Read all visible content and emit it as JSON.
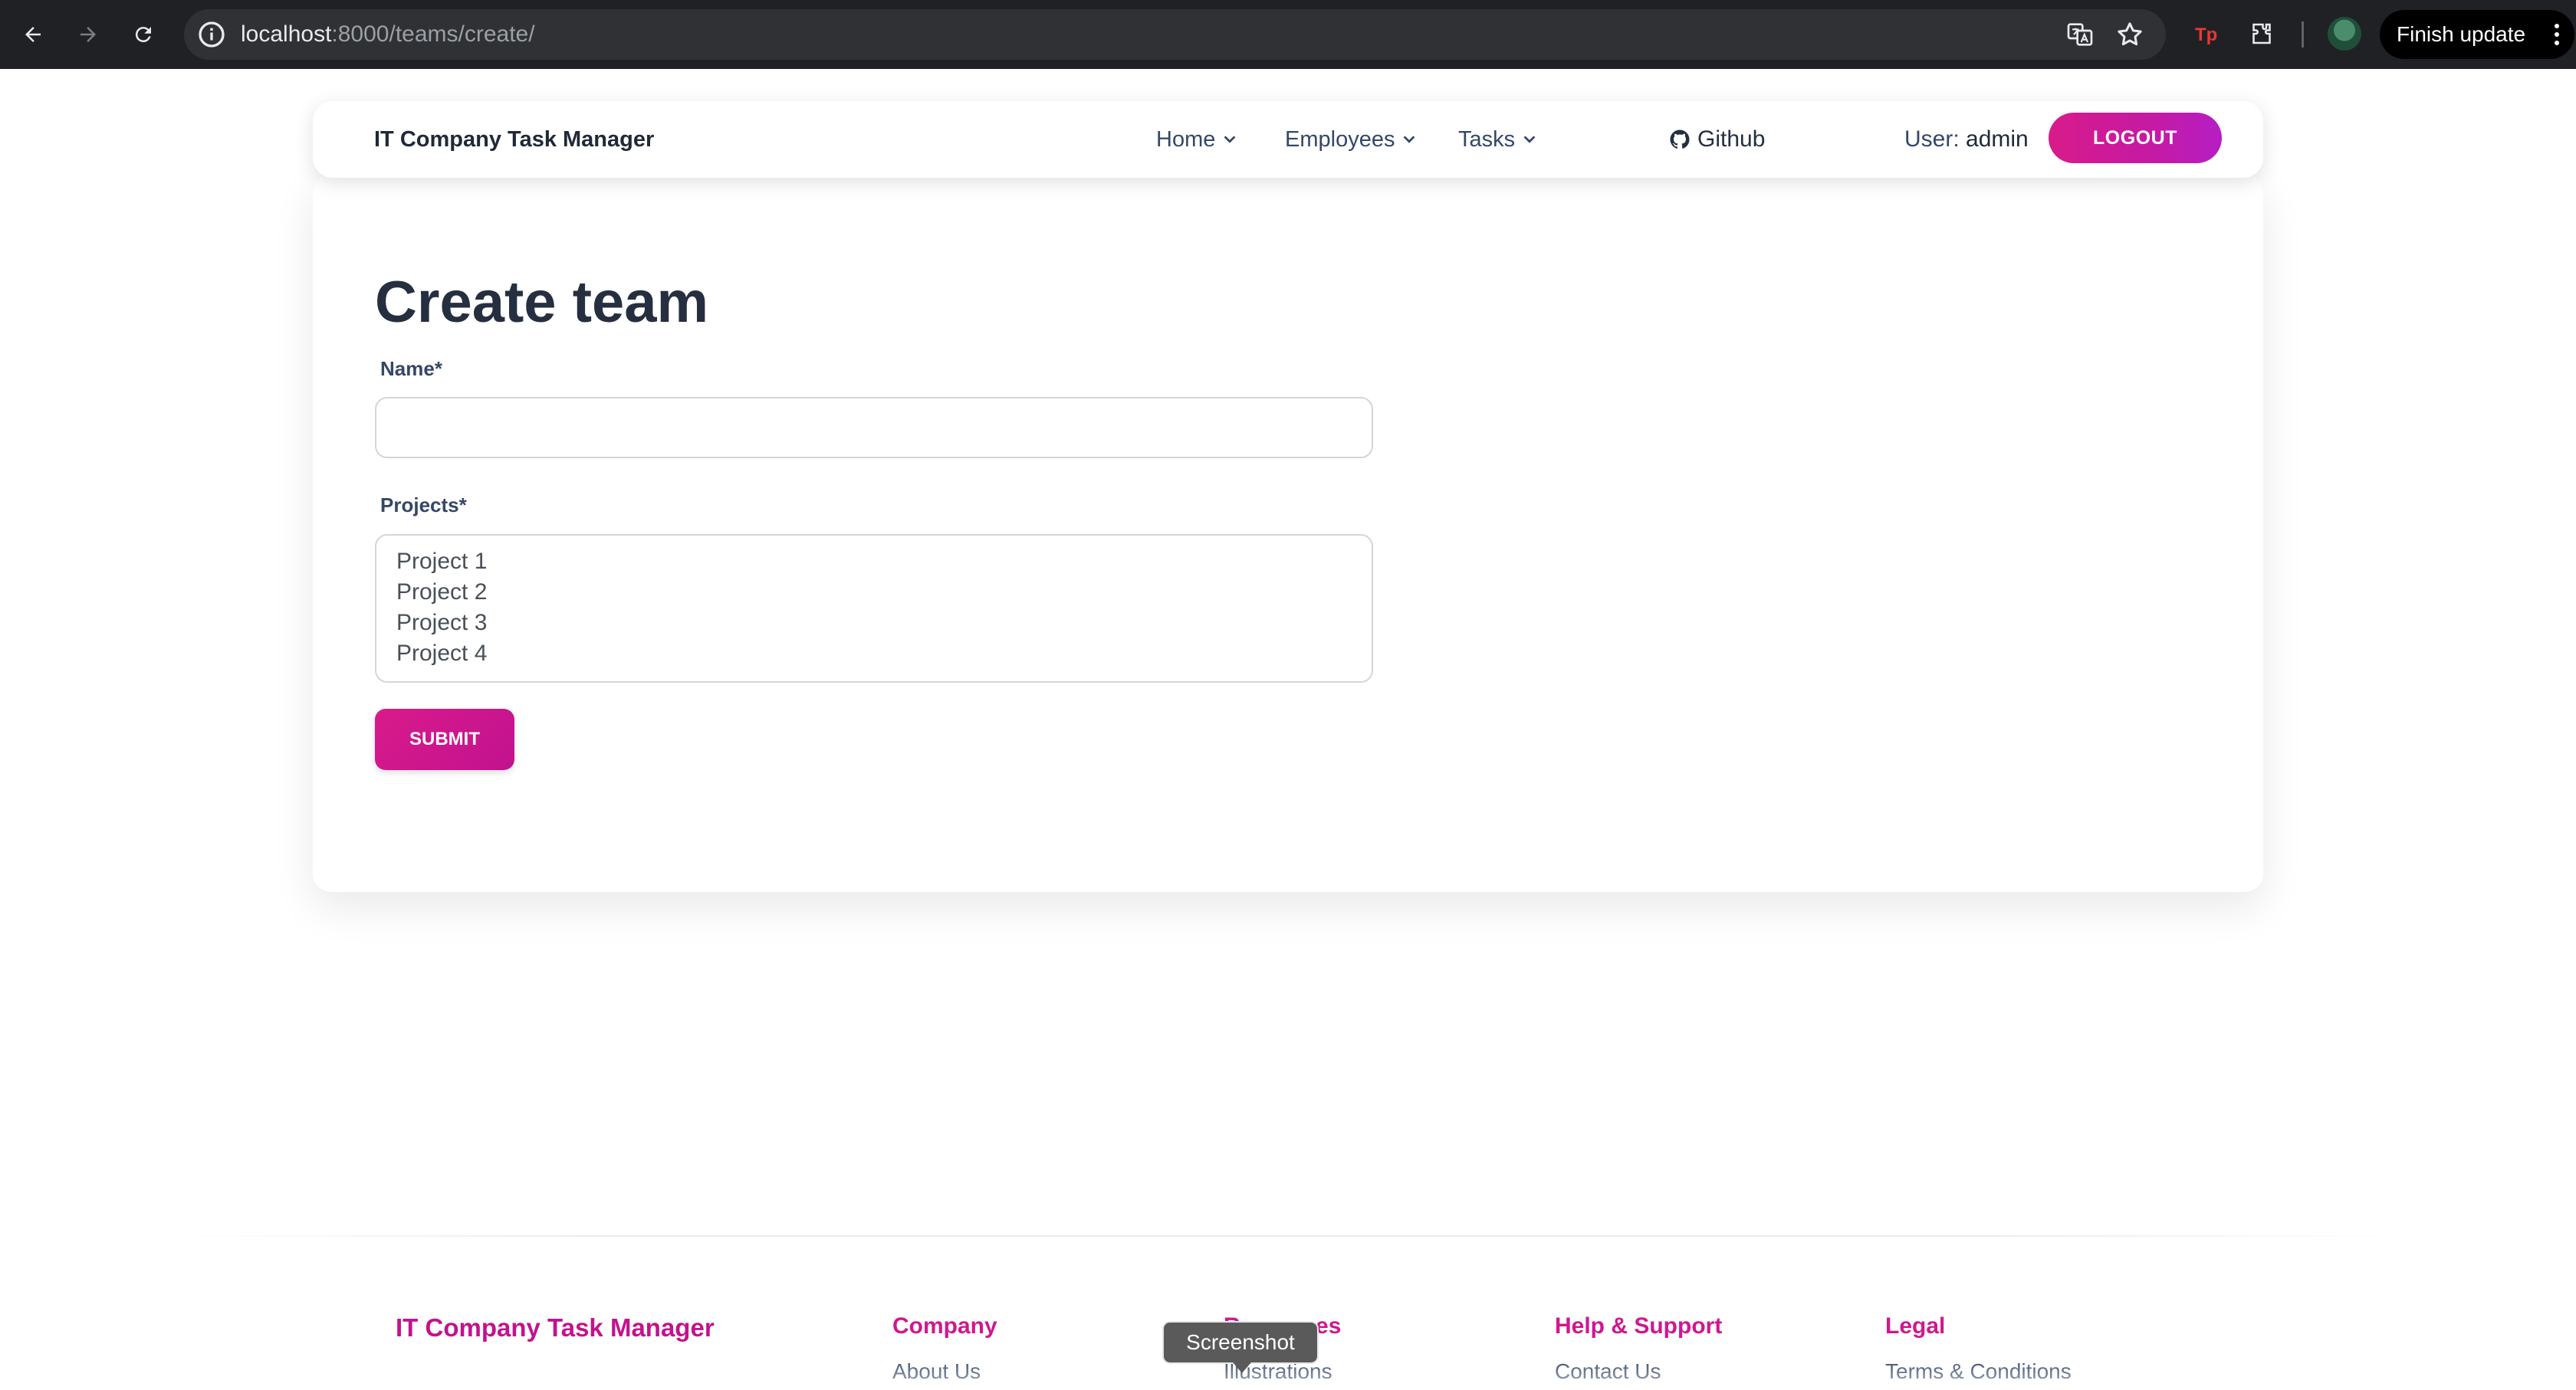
{
  "browser": {
    "url_host": "localhost",
    "url_path": ":8000/teams/create/",
    "update_label": "Finish update"
  },
  "navbar": {
    "brand": "IT Company Task Manager",
    "items": [
      {
        "label": "Home"
      },
      {
        "label": "Employees"
      },
      {
        "label": "Tasks"
      }
    ],
    "github_label": "Github",
    "user_prefix": "User:",
    "username": "admin",
    "logout_label": "LOGOUT"
  },
  "form": {
    "title": "Create team",
    "name_label": "Name*",
    "name_value": "",
    "projects_label": "Projects*",
    "projects": [
      "Project 1",
      "Project 2",
      "Project 3",
      "Project 4"
    ],
    "submit_label": "SUBMIT"
  },
  "footer": {
    "brand": "IT Company Task Manager",
    "columns": [
      {
        "title": "Company",
        "first_link": "About Us"
      },
      {
        "title": "Resources",
        "first_link": "Illustrations"
      },
      {
        "title": "Help & Support",
        "first_link": "Contact Us"
      },
      {
        "title": "Legal",
        "first_link": "Terms & Conditions"
      }
    ]
  },
  "tooltip": "Screenshot",
  "colors": {
    "accent": "#c2128f",
    "chrome_bg": "#202124",
    "title": "#252f40"
  }
}
